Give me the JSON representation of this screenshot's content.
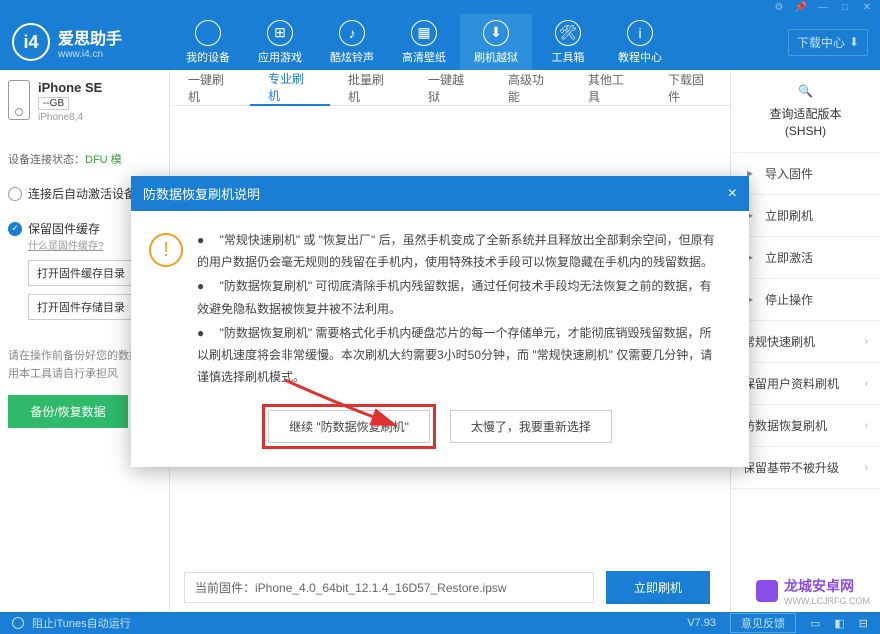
{
  "titlebar": {
    "icons": [
      "gear",
      "pin",
      "min",
      "max",
      "close"
    ]
  },
  "logo": {
    "mark": "i4",
    "title": "爱思助手",
    "url": "www.i4.cn"
  },
  "nav": [
    {
      "icon": "",
      "label": "我的设备"
    },
    {
      "icon": "⊞",
      "label": "应用游戏"
    },
    {
      "icon": "♪",
      "label": "酷炫铃声"
    },
    {
      "icon": "▦",
      "label": "高清壁纸"
    },
    {
      "icon": "⬇",
      "label": "刷机越狱",
      "active": true
    },
    {
      "icon": "🛠",
      "label": "工具箱"
    },
    {
      "icon": "i",
      "label": "教程中心"
    }
  ],
  "download_center": "下载中心",
  "device": {
    "name": "iPhone SE",
    "capacity": "--GB",
    "model": "iPhone8,4"
  },
  "conn": {
    "label": "设备连接状态：",
    "value": "DFU 模"
  },
  "opts": {
    "opt1": "连接后自动激活设备",
    "opt2": "保留固件缓存",
    "opt2_link": "什么是固件缓存?",
    "btn1": "打开固件缓存目录",
    "btn2": "打开固件存储目录"
  },
  "hint": "请在操作前备份好您的数据\n使用本工具请自行承担风",
  "backup_btn": "备份/恢复数据",
  "tabs": [
    "一键刷机",
    "专业刷机",
    "批量刷机",
    "一键越狱",
    "高级功能",
    "其他工具",
    "下载固件"
  ],
  "active_tab_index": 1,
  "fw": {
    "label": "当前固件：",
    "file": "iPhone_4.0_64bit_12.1.4_16D57_Restore.ipsw",
    "btn": "立即刷机"
  },
  "right": {
    "head1": "查询适配版本",
    "head2": "(SHSH)",
    "items": [
      "导入固件",
      "立即刷机",
      "立即激活",
      "停止操作"
    ],
    "modes": [
      "常规快速刷机",
      "保留用户资料刷机",
      "防数据恢复刷机",
      "保留基带不被升级"
    ]
  },
  "modal": {
    "title": "防数据恢复刷机说明",
    "p1": "● 　\"常规快速刷机\" 或 \"恢复出厂\" 后，虽然手机变成了全新系统并且释放出全部剩余空间，但原有的用户数据仍会毫无规则的残留在手机内，使用特殊技术手段可以恢复隐藏在手机内的残留数据。",
    "p2": "● 　\"防数据恢复刷机\" 可彻底清除手机内残留数据，通过任何技术手段均无法恢复之前的数据，有效避免隐私数据被恢复并被不法利用。",
    "p3": "● 　\"防数据恢复刷机\" 需要格式化手机内硬盘芯片的每一个存储单元，才能彻底销毁残留数据，所以刷机速度将会非常缓慢。本次刷机大约需要3小时50分钟，而 \"常规快速刷机\" 仅需要几分钟，请谨慎选择刷机模式。",
    "btn_continue": "继续 \"防数据恢复刷机\"",
    "btn_cancel": "太慢了，我要重新选择"
  },
  "status": {
    "itunes": "阻止iTunes自动运行",
    "ver": "V7.93",
    "feedback": "意见反馈"
  },
  "watermark": {
    "name": "龙城安卓网",
    "url": "WWW.LCJRFG.COM"
  }
}
